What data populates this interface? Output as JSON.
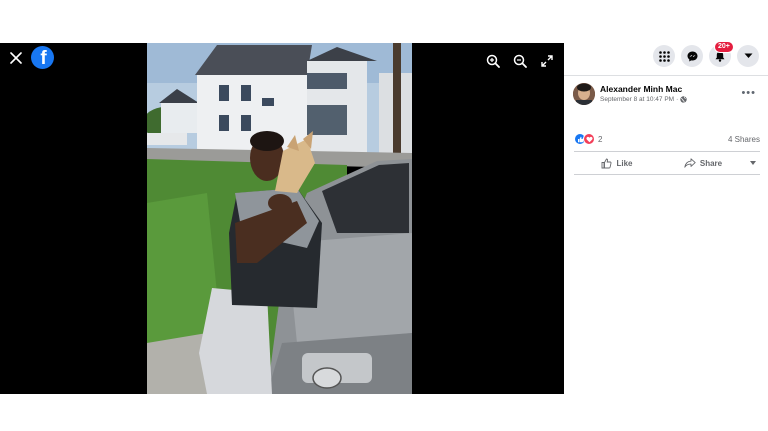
{
  "viewer": {
    "logo_letter": "f",
    "icons": [
      "close-icon",
      "zoom-in-icon",
      "zoom-out-icon",
      "fullscreen-icon"
    ]
  },
  "top_bar": {
    "notifications_badge": "20+",
    "icons": [
      "menu-grid-icon",
      "messenger-icon",
      "bell-icon",
      "chevron-down-icon"
    ]
  },
  "post": {
    "author_name": "Alexander Minh Mac",
    "timestamp": "September 8 at 10:47 PM",
    "separator": "·",
    "more_label": "•••",
    "reaction_count": "2",
    "shares": "4 Shares",
    "like_label": "Like",
    "share_label": "Share"
  },
  "colors": {
    "facebook_blue": "#1877f2",
    "love_red": "#f33e58",
    "badge_red": "#e41e3f"
  }
}
